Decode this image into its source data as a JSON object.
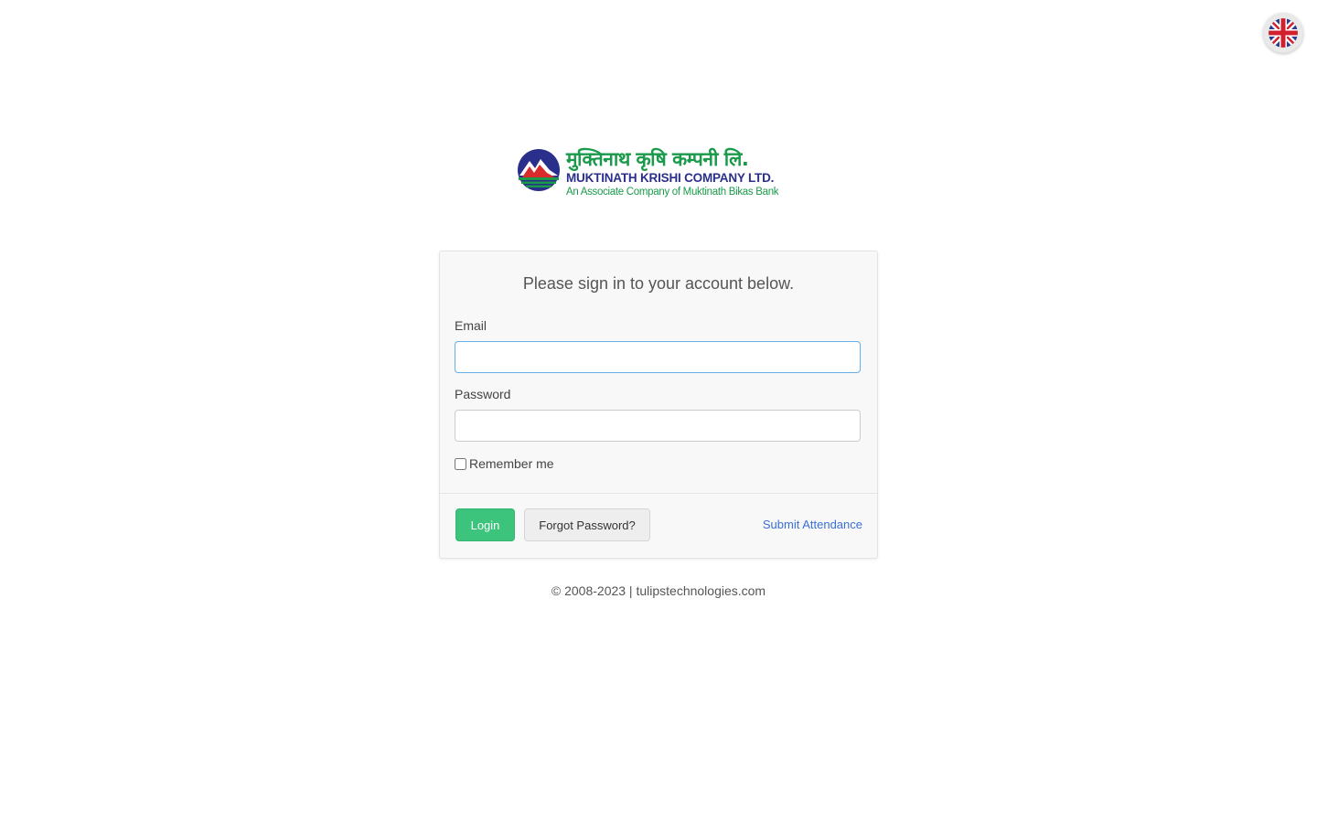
{
  "language": {
    "icon": "uk-flag-icon"
  },
  "logo": {
    "nepali_name": "मुक्तिनाथ कृषि कम्पनी लि.",
    "english_name": "MUKTINATH KRISHI COMPANY LTD.",
    "tagline": "An Associate Company of Muktinath Bikas Bank",
    "colors": {
      "green": "#1a9a4a",
      "navy": "#2b2f8c",
      "red": "#d92b2b"
    }
  },
  "form": {
    "title": "Please sign in to your account below.",
    "email_label": "Email",
    "email_value": "",
    "password_label": "Password",
    "password_value": "",
    "remember_label": "Remember me",
    "remember_checked": false,
    "login_button": "Login",
    "forgot_button": "Forgot Password?",
    "attendance_link": "Submit Attendance"
  },
  "colors": {
    "login_button": "#3cc47c",
    "link": "#3a6fd8",
    "focus_border": "#66afe9"
  },
  "footer": {
    "text": "© 2008-2023 | tulipstechnologies.com"
  }
}
